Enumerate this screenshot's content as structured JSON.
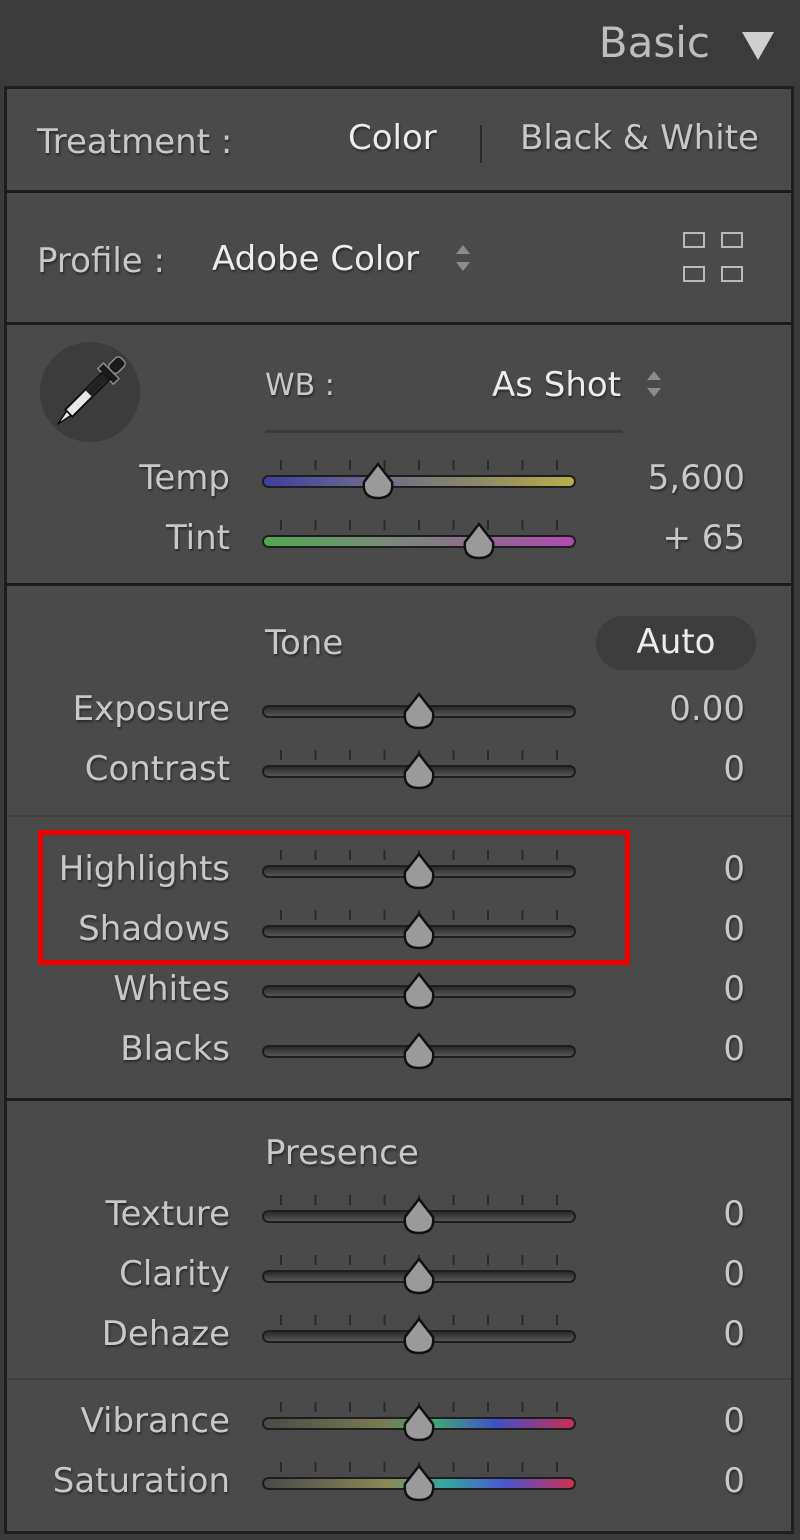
{
  "panel": {
    "title": "Basic",
    "collapse_icon": "triangle-down-icon"
  },
  "treatment": {
    "label": "Treatment :",
    "options": [
      "Color",
      "Black & White"
    ],
    "selected": "Color"
  },
  "profile": {
    "label": "Profile :",
    "value": "Adobe Color",
    "browser_icon": "grid-icon"
  },
  "wb": {
    "label": "WB :",
    "value": "As Shot",
    "picker_icon": "eyedropper-icon"
  },
  "sliders": {
    "temp": {
      "label": "Temp",
      "value": "5,600",
      "position": 0.37
    },
    "tint": {
      "label": "Tint",
      "value": "+ 65",
      "position": 0.69
    }
  },
  "tone": {
    "heading": "Tone",
    "auto_label": "Auto",
    "exposure": {
      "label": "Exposure",
      "value": "0.00",
      "position": 0.5
    },
    "contrast": {
      "label": "Contrast",
      "value": "0",
      "position": 0.5
    },
    "highlights": {
      "label": "Highlights",
      "value": "0",
      "position": 0.5
    },
    "shadows": {
      "label": "Shadows",
      "value": "0",
      "position": 0.5
    },
    "whites": {
      "label": "Whites",
      "value": "0",
      "position": 0.5
    },
    "blacks": {
      "label": "Blacks",
      "value": "0",
      "position": 0.5
    }
  },
  "presence": {
    "heading": "Presence",
    "texture": {
      "label": "Texture",
      "value": "0",
      "position": 0.5
    },
    "clarity": {
      "label": "Clarity",
      "value": "0",
      "position": 0.5
    },
    "dehaze": {
      "label": "Dehaze",
      "value": "0",
      "position": 0.5
    },
    "vibrance": {
      "label": "Vibrance",
      "value": "0",
      "position": 0.5
    },
    "saturation": {
      "label": "Saturation",
      "value": "0",
      "position": 0.5
    }
  },
  "colors": {
    "background": "#3a3a3a",
    "panel": "#4a4a4a",
    "highlight_box": "#ee0000"
  }
}
